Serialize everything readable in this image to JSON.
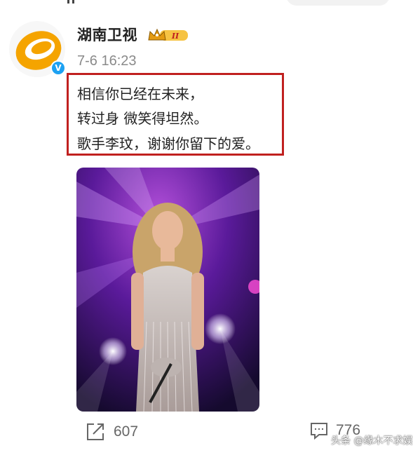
{
  "post": {
    "author": "湖南卫视",
    "vip_level": "II",
    "timestamp": "7-6 16:23",
    "text_lines": [
      "相信你已经在未来，",
      "转过身 微笑得坦然。",
      "歌手李玟，谢谢你留下的爱。"
    ]
  },
  "actions": {
    "repost_count": "607",
    "comment_count": "776"
  },
  "watermark": "头条 @缘木不求娱",
  "colors": {
    "highlight_border": "#c0201f",
    "verified_badge": "#1da1f2",
    "logo_orange": "#f5a400"
  },
  "icons": [
    "verified-icon",
    "vip-crown-icon",
    "repost-icon",
    "comment-icon"
  ]
}
